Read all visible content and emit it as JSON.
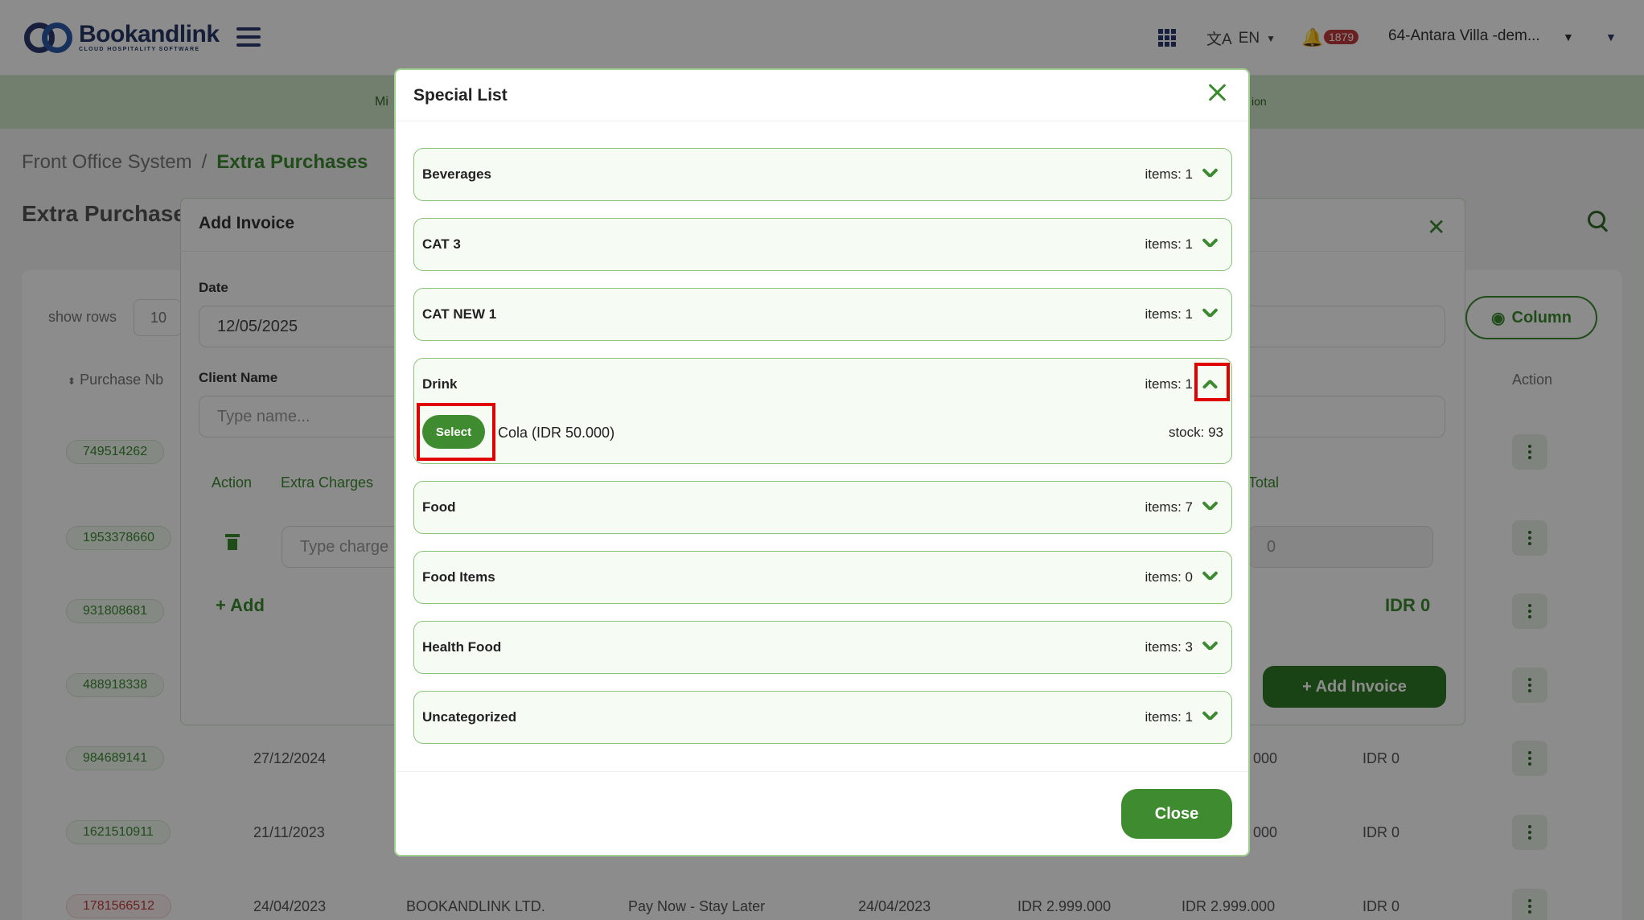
{
  "app": {
    "logo_name": "Bookandlink",
    "logo_sub": "CLOUD HOSPITALITY SOFTWARE",
    "language": "EN",
    "notification_count": "1879",
    "property": "64-Antara Villa -dem..."
  },
  "subnav": {
    "left_fragment": "Mi",
    "right_fragment": "ion"
  },
  "breadcrumb": {
    "root": "Front Office System",
    "separator": "/",
    "current": "Extra Purchases"
  },
  "page": {
    "heading": "Extra Purchases",
    "show_rows_label": "show rows",
    "rows_value": "10",
    "column_button": "Column",
    "col_purchase": "Purchase Nb",
    "col_action": "Action"
  },
  "table": {
    "rows": [
      {
        "nb": "749514262",
        "status": "green"
      },
      {
        "nb": "1953378660",
        "status": "green"
      },
      {
        "nb": "931808681",
        "status": "green"
      },
      {
        "nb": "488918338",
        "status": "green"
      },
      {
        "nb": "984689141",
        "status": "green",
        "date": "27/12/2024",
        "c1": "000",
        "c2": "IDR 0"
      },
      {
        "nb": "1621510911",
        "status": "green",
        "date": "21/11/2023",
        "c1": "000",
        "c2": "IDR 0"
      },
      {
        "nb": "1781566512",
        "status": "red",
        "date": "24/04/2023",
        "company": "BOOKANDLINK LTD.",
        "scheme": "Pay Now - Stay Later",
        "date2": "24/04/2023",
        "amt1": "IDR 2.999.000",
        "amt2": "IDR 2.999.000",
        "c2": "IDR 0"
      }
    ]
  },
  "invoice_modal": {
    "title": "Add Invoice",
    "date_label": "Date",
    "date_value": "12/05/2025",
    "client_label": "Client Name",
    "client_placeholder": "Type name...",
    "tab_action": "Action",
    "tab_extra_charges": "Extra Charges",
    "tab_total": "Total",
    "charge_placeholder": "Type charge",
    "total_value": "0",
    "add_label": "+ Add",
    "idr_total": "IDR 0",
    "add_invoice_button": "+ Add Invoice"
  },
  "special_list": {
    "title": "Special List",
    "close_button": "Close",
    "categories": [
      {
        "name": "Beverages",
        "items": "items: 1",
        "expanded": false
      },
      {
        "name": "CAT 3",
        "items": "items: 1",
        "expanded": false
      },
      {
        "name": "CAT NEW 1",
        "items": "items: 1",
        "expanded": false
      },
      {
        "name": "Drink",
        "items": "items: 1",
        "expanded": true,
        "products": [
          {
            "select_label": "Select",
            "name": "Cola (IDR 50.000)",
            "stock": "stock: 93"
          }
        ]
      },
      {
        "name": "Food",
        "items": "items: 7",
        "expanded": false
      },
      {
        "name": "Food Items",
        "items": "items: 0",
        "expanded": false
      },
      {
        "name": "Health Food",
        "items": "items: 3",
        "expanded": false
      },
      {
        "name": "Uncategorized",
        "items": "items: 1",
        "expanded": false
      }
    ]
  },
  "colors": {
    "accent": "#3b8a30",
    "accent_dark": "#2f7a25",
    "brand_navy": "#253766",
    "highlight": "#e00000",
    "badge_red": "#c23b3b"
  }
}
